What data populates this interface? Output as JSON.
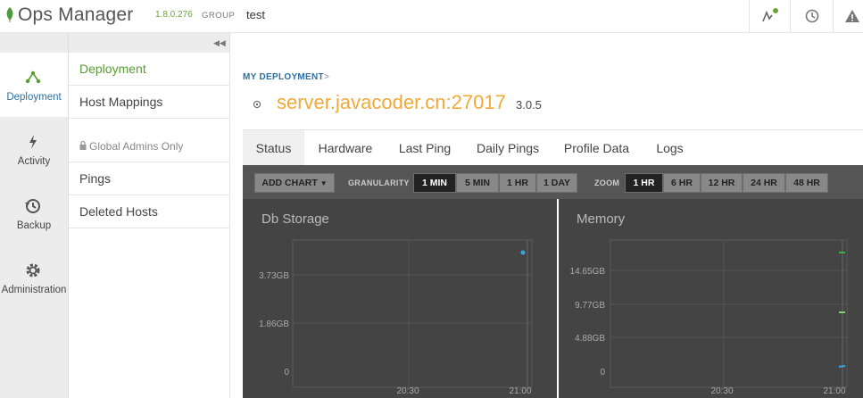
{
  "header": {
    "app_name": "Ops Manager",
    "version": "1.8.0.276",
    "group_label": "GROUP",
    "group_value": "test",
    "icons": [
      "activity-monitor-icon",
      "history-icon",
      "alert-icon"
    ],
    "status_dot_color": "#6ba43a"
  },
  "leftnav": {
    "items": [
      {
        "label": "Deployment",
        "icon": "deployment-icon",
        "active": true
      },
      {
        "label": "Activity",
        "icon": "lightning-icon",
        "active": false
      },
      {
        "label": "Backup",
        "icon": "backup-icon",
        "active": false
      },
      {
        "label": "Administration",
        "icon": "gear-icon",
        "active": false
      }
    ]
  },
  "subnav": {
    "items": [
      {
        "label": "Deployment",
        "active": true
      },
      {
        "label": "Host Mappings"
      },
      {
        "label": "Global Admins Only",
        "section": true
      },
      {
        "label": "Pings"
      },
      {
        "label": "Deleted Hosts"
      }
    ]
  },
  "main": {
    "breadcrumb": "MY DEPLOYMENT",
    "breadcrumb_sep": ">",
    "server_name": "server.javacoder.cn:27017",
    "server_version": "3.0.5",
    "tabs": [
      "Status",
      "Hardware",
      "Last Ping",
      "Daily Pings",
      "Profile Data",
      "Logs"
    ],
    "active_tab": "Status"
  },
  "toolbar": {
    "add_chart": "ADD CHART",
    "granularity_label": "GRANULARITY",
    "granularity_options": [
      "1 MIN",
      "5 MIN",
      "1 HR",
      "1 DAY"
    ],
    "granularity_selected": "1 MIN",
    "zoom_label": "ZOOM",
    "zoom_options": [
      "1 HR",
      "6 HR",
      "12 HR",
      "24 HR",
      "48 HR"
    ],
    "zoom_selected": "1 HR"
  },
  "charts": [
    {
      "title": "Db Storage",
      "yticks": [
        "3.73GB",
        "1.86GB",
        "0"
      ],
      "xticks": [
        "20:30",
        "21:00"
      ]
    },
    {
      "title": "Memory",
      "yticks": [
        "14.65GB",
        "9.77GB",
        "4.88GB",
        "0"
      ],
      "xticks": [
        "20:30",
        "21:00"
      ]
    }
  ],
  "colors": {
    "accent_green": "#5a9b33",
    "server_orange": "#f0a93b",
    "link_blue": "#2f6f9f"
  }
}
